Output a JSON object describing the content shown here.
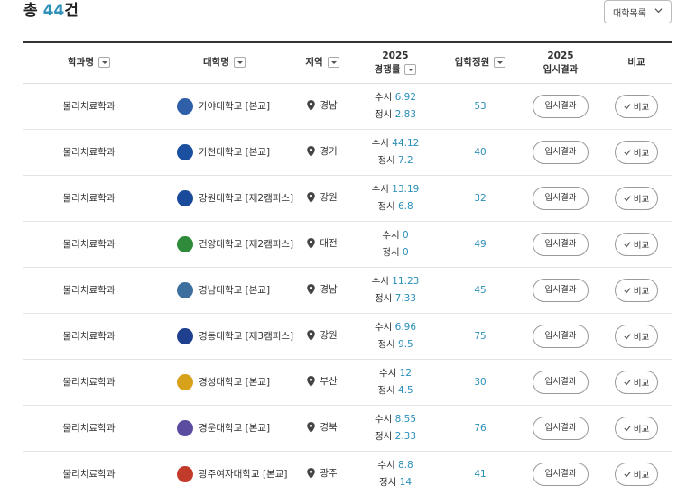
{
  "header": {
    "total_prefix": "총",
    "total_count": "44",
    "total_suffix": "건",
    "sort_select_label": "대학목록"
  },
  "columns": {
    "dept": "학과명",
    "univ": "대학명",
    "region": "지역",
    "rate_year": "2025",
    "rate_label": "경쟁률",
    "capacity": "입학정원",
    "result_year": "2025",
    "result_label": "입시결과",
    "compare": "비교"
  },
  "rows": [
    {
      "dept": "물리치료학과",
      "univ": "가야대학교 [본교]",
      "logo_icon": "gaya-logo-icon",
      "logo_color": "#2f5fa8",
      "region": "경남",
      "susi_label": "수시",
      "susi": "6.92",
      "jeongsi_label": "정시",
      "jeongsi": "2.83",
      "capacity": "53",
      "result_btn": "입시결과",
      "compare_btn": "비교"
    },
    {
      "dept": "물리치료학과",
      "univ": "가천대학교 [본교]",
      "logo_icon": "gachon-logo-icon",
      "logo_color": "#1b4fa0",
      "region": "경기",
      "susi_label": "수시",
      "susi": "44.12",
      "jeongsi_label": "정시",
      "jeongsi": "7.2",
      "capacity": "40",
      "result_btn": "입시결과",
      "compare_btn": "비교"
    },
    {
      "dept": "물리치료학과",
      "univ": "강원대학교 [제2캠퍼스]",
      "logo_icon": "knu-logo-icon",
      "logo_color": "#1a4b9a",
      "region": "강원",
      "susi_label": "수시",
      "susi": "13.19",
      "jeongsi_label": "정시",
      "jeongsi": "6.8",
      "capacity": "32",
      "result_btn": "입시결과",
      "compare_btn": "비교"
    },
    {
      "dept": "물리치료학과",
      "univ": "건양대학교 [제2캠퍼스]",
      "logo_icon": "ky-logo-icon",
      "logo_color": "#2e8b3a",
      "region": "대전",
      "susi_label": "수시",
      "susi": "0",
      "jeongsi_label": "정시",
      "jeongsi": "0",
      "capacity": "49",
      "result_btn": "입시결과",
      "compare_btn": "비교"
    },
    {
      "dept": "물리치료학과",
      "univ": "경남대학교 [본교]",
      "logo_icon": "kyungnam-shield-icon",
      "logo_color": "#3d6f9e",
      "region": "경남",
      "susi_label": "수시",
      "susi": "11.23",
      "jeongsi_label": "정시",
      "jeongsi": "7.33",
      "capacity": "45",
      "result_btn": "입시결과",
      "compare_btn": "비교"
    },
    {
      "dept": "물리치료학과",
      "univ": "경동대학교 [제3캠퍼스]",
      "logo_icon": "kyungdong-logo-icon",
      "logo_color": "#1f3f8f",
      "region": "강원",
      "susi_label": "수시",
      "susi": "6.96",
      "jeongsi_label": "정시",
      "jeongsi": "9.5",
      "capacity": "75",
      "result_btn": "입시결과",
      "compare_btn": "비교"
    },
    {
      "dept": "물리치료학과",
      "univ": "경성대학교 [본교]",
      "logo_icon": "kyungsung-logo-icon",
      "logo_color": "#d8a11a",
      "region": "부산",
      "susi_label": "수시",
      "susi": "12",
      "jeongsi_label": "정시",
      "jeongsi": "4.5",
      "capacity": "30",
      "result_btn": "입시결과",
      "compare_btn": "비교"
    },
    {
      "dept": "물리치료학과",
      "univ": "경운대학교 [본교]",
      "logo_icon": "kyungwoon-logo-icon",
      "logo_color": "#5b4ca0",
      "region": "경북",
      "susi_label": "수시",
      "susi": "8.55",
      "jeongsi_label": "정시",
      "jeongsi": "2.33",
      "capacity": "76",
      "result_btn": "입시결과",
      "compare_btn": "비교"
    },
    {
      "dept": "물리치료학과",
      "univ": "광주여자대학교 [본교]",
      "logo_icon": "kwangju-womens-logo-icon",
      "logo_color": "#c23a2a",
      "region": "광주",
      "susi_label": "수시",
      "susi": "8.8",
      "jeongsi_label": "정시",
      "jeongsi": "14",
      "capacity": "41",
      "result_btn": "입시결과",
      "compare_btn": "비교"
    }
  ],
  "colors": {
    "accent": "#2a8fb8",
    "header_border": "#333333",
    "row_border": "#e4e4e4"
  }
}
